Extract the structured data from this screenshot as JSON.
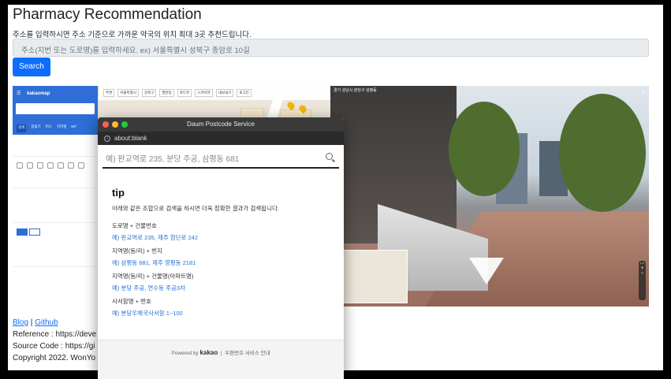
{
  "header": {
    "title": "Pharmacy Recommendation",
    "description": "주소를 입력하시면 주소 기준으로 가까운 약국의 위치 최대 3곳 추천드립니다.",
    "address_placeholder": "주소(지번 또는 도로명)를 입력하세요. ex) 서울특별시 성북구 종암로 10길",
    "search_label": "Search"
  },
  "kakao_panel": {
    "logo": "kakaomap",
    "tabs": [
      "검색",
      "길찾기",
      "버스",
      "지하철",
      "MY"
    ]
  },
  "map": {
    "toolbar": [
      "주변",
      "서울특별시",
      "강북구",
      "팔반동",
      "로드뷰",
      "스카이뷰",
      "내보내기",
      "로그인"
    ]
  },
  "street_view": {
    "location": "경기 성남시 분당구 삼평동"
  },
  "footer": {
    "blog": "Blog",
    "separator": "|",
    "github": "Github",
    "reference": "Reference : https://deve",
    "source": "Source Code : https://gi",
    "copyright": "Copyright 2022. WonYo"
  },
  "popup": {
    "window_title": "Daum Postcode Service",
    "url": "about:blank",
    "search_placeholder": "예) 판교역로 235, 분당 주공, 삼평동 681",
    "tip_title": "tip",
    "tip_desc": "아래와 같은 조합으로 검색을 하시면 더욱 정확한 결과가 검색됩니다.",
    "tips": [
      {
        "key": "도로명 + 건물번호",
        "example": "예) 판교역로 235,  제주 첨단로 242"
      },
      {
        "key": "지역명(동/리) + 번지",
        "example": "예) 삼평동 681,  제주 영평동 2181"
      },
      {
        "key": "지역명(동/리) + 건물명(아파트명)",
        "example": "예) 분당 주공,  연수동 주공3차"
      },
      {
        "key": "사서함명 + 번호",
        "example": "예) 분당우체국사서함 1~100"
      }
    ],
    "powered_by": "Powered by",
    "brand": "kakao",
    "postcode_info": "우편번호 서비스 안내"
  }
}
